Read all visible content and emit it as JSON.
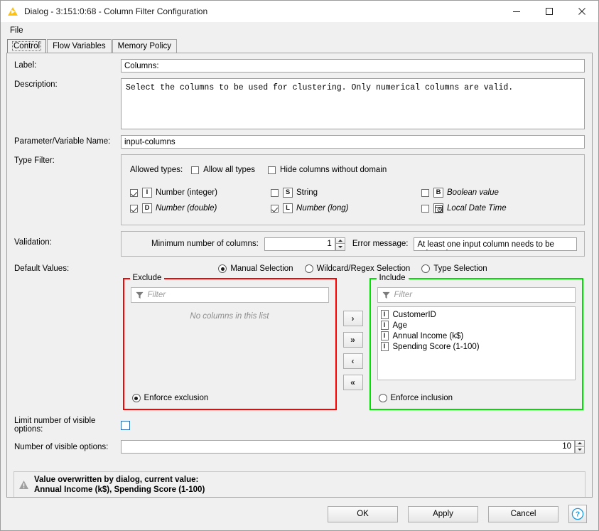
{
  "window": {
    "title": "Dialog - 3:151:0:68 - Column Filter Configuration",
    "icon": "knime-triangle-icon",
    "minimize": "—",
    "maximize": "☐",
    "close": "✕"
  },
  "menu": {
    "items": [
      "File"
    ]
  },
  "tabs": [
    {
      "label": "Control",
      "active": true
    },
    {
      "label": "Flow Variables",
      "active": false
    },
    {
      "label": "Memory Policy",
      "active": false
    }
  ],
  "form": {
    "label_row": {
      "label": "Label:",
      "value": "Columns:"
    },
    "description_row": {
      "label": "Description:",
      "value": "Select the columns to be used for clustering. Only numerical columns are valid."
    },
    "param_row": {
      "label": "Parameter/Variable Name:",
      "value": "input-columns"
    },
    "type_filter_row": {
      "label": "Type Filter:"
    },
    "validation_row": {
      "label": "Validation:"
    },
    "defaults_row": {
      "label": "Default Values:"
    }
  },
  "type_filter": {
    "allowed_types_label": "Allowed types:",
    "allow_all_types": {
      "label": "Allow all types",
      "checked": false
    },
    "hide_no_domain": {
      "label": "Hide columns without domain",
      "checked": false
    },
    "types": [
      {
        "icon": "I",
        "icon_name": "integer-type-icon",
        "label": "Number (integer)",
        "checked": true,
        "italic": false
      },
      {
        "icon": "D",
        "icon_name": "double-type-icon",
        "label": "Number (double)",
        "checked": true,
        "italic": true
      },
      {
        "icon": "S",
        "icon_name": "string-type-icon",
        "label": "String",
        "checked": false,
        "italic": false
      },
      {
        "icon": "L",
        "icon_name": "long-type-icon",
        "label": "Number (long)",
        "checked": true,
        "italic": true
      },
      {
        "icon": "B",
        "icon_name": "boolean-type-icon",
        "label": "Boolean value",
        "checked": false,
        "italic": true
      },
      {
        "icon": "Ὕ3",
        "icon_name": "local-date-time-icon",
        "label": "Local Date Time",
        "checked": false,
        "italic": true
      }
    ]
  },
  "validation": {
    "min_columns_label": "Minimum number of columns:",
    "min_columns_value": "1",
    "error_message_label": "Error message:",
    "error_message_value": "At least one input column needs to be selected."
  },
  "default_values": {
    "modes": [
      {
        "label": "Manual Selection",
        "selected": true
      },
      {
        "label": "Wildcard/Regex Selection",
        "selected": false
      },
      {
        "label": "Type Selection",
        "selected": false
      }
    ],
    "exclude": {
      "title": "Exclude",
      "border_color": "#ff0000",
      "filter_placeholder": "Filter",
      "empty_message": "No columns in this list",
      "items": [],
      "enforce": {
        "label": "Enforce exclusion",
        "selected": true
      }
    },
    "include": {
      "title": "Include",
      "border_color": "#00e000",
      "filter_placeholder": "Filter",
      "items": [
        {
          "icon": "I",
          "label": "CustomerID"
        },
        {
          "icon": "I",
          "label": "Age"
        },
        {
          "icon": "I",
          "label": "Annual Income (k$)"
        },
        {
          "icon": "I",
          "label": "Spending Score (1-100)"
        }
      ],
      "enforce": {
        "label": "Enforce inclusion",
        "selected": false
      }
    },
    "transfer_buttons": [
      {
        "label": "›",
        "name": "move-right-button"
      },
      {
        "label": "»",
        "name": "move-all-right-button"
      },
      {
        "label": "‹",
        "name": "move-left-button"
      },
      {
        "label": "«",
        "name": "move-all-left-button"
      }
    ]
  },
  "bottom": {
    "limit_visible_label": "Limit number of visible options:",
    "limit_visible_checked": false,
    "number_visible_label": "Number of visible options:",
    "number_visible_value": "10"
  },
  "warning": {
    "icon": "warning-triangle-icon",
    "line1": "Value overwritten by dialog, current value:",
    "line2": "Annual Income (k$), Spending Score (1-100)"
  },
  "footer": {
    "ok": "OK",
    "apply": "Apply",
    "cancel": "Cancel",
    "help": "?"
  }
}
